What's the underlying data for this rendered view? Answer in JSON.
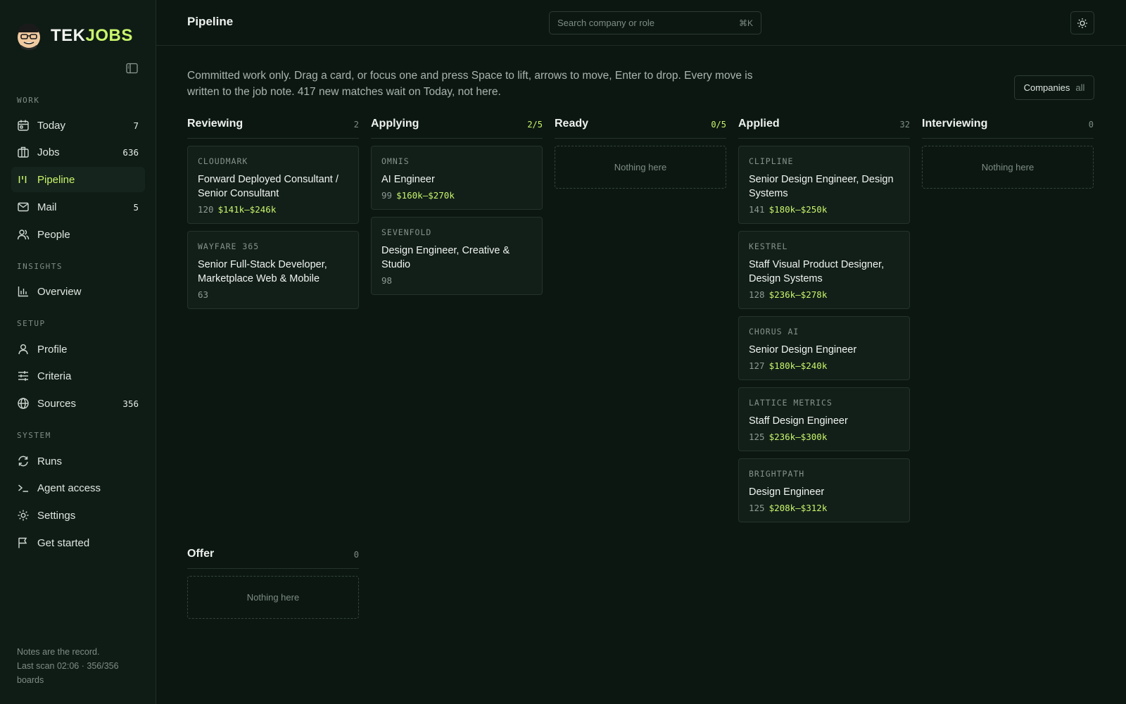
{
  "brand": {
    "part1": "TEK",
    "part2": "JOBS"
  },
  "sidebar": {
    "sections": {
      "work": "WORK",
      "insights": "INSIGHTS",
      "setup": "SETUP",
      "system": "SYSTEM"
    },
    "items": [
      {
        "label": "Today",
        "count": "7",
        "icon": "calendar-icon"
      },
      {
        "label": "Jobs",
        "count": "636",
        "icon": "briefcase-icon"
      },
      {
        "label": "Pipeline",
        "count": "",
        "icon": "kanban-icon"
      },
      {
        "label": "Mail",
        "count": "5",
        "icon": "mail-icon"
      },
      {
        "label": "People",
        "count": "",
        "icon": "people-icon"
      },
      {
        "label": "Overview",
        "count": "",
        "icon": "bar-chart-icon"
      },
      {
        "label": "Profile",
        "count": "",
        "icon": "user-icon"
      },
      {
        "label": "Criteria",
        "count": "",
        "icon": "sliders-icon"
      },
      {
        "label": "Sources",
        "count": "356",
        "icon": "globe-icon"
      },
      {
        "label": "Runs",
        "count": "",
        "icon": "refresh-icon"
      },
      {
        "label": "Agent access",
        "count": "",
        "icon": "terminal-icon"
      },
      {
        "label": "Settings",
        "count": "",
        "icon": "gear-icon"
      },
      {
        "label": "Get started",
        "count": "",
        "icon": "flag-icon"
      }
    ],
    "footer": {
      "line1": "Notes are the record.",
      "line2": "Last scan 02:06 · 356/356 boards"
    }
  },
  "header": {
    "title": "Pipeline",
    "search_placeholder": "Search company or role",
    "search_shortcut": "⌘K"
  },
  "intro": "Committed work only. Drag a card, or focus one and press Space to lift, arrows to move, Enter to drop. Every move is written to the job note. 417 new matches wait on Today, not here.",
  "companies_filter": {
    "label": "Companies",
    "value": "all"
  },
  "empty_text": "Nothing here",
  "columns": {
    "reviewing": {
      "title": "Reviewing",
      "count": "2",
      "cards": [
        {
          "company": "CLOUDMARK",
          "role": "Forward Deployed Consultant / Senior Consultant",
          "score": "120",
          "salary": "$141k–$246k"
        },
        {
          "company": "WAYFARE 365",
          "role": "Senior Full-Stack Developer, Marketplace Web & Mobile",
          "score": "63",
          "salary": ""
        }
      ]
    },
    "applying": {
      "title": "Applying",
      "count": "2/5",
      "cards": [
        {
          "company": "OMNIS",
          "role": "AI Engineer",
          "score": "99",
          "salary": "$160k–$270k"
        },
        {
          "company": "SEVENFOLD",
          "role": "Design Engineer, Creative & Studio",
          "score": "98",
          "salary": ""
        }
      ]
    },
    "ready": {
      "title": "Ready",
      "count": "0/5",
      "cards": []
    },
    "applied": {
      "title": "Applied",
      "count": "32",
      "cards": [
        {
          "company": "CLIPLINE",
          "role": "Senior Design Engineer, Design Systems",
          "score": "141",
          "salary": "$180k–$250k"
        },
        {
          "company": "KESTREL",
          "role": "Staff Visual Product Designer, Design Systems",
          "score": "128",
          "salary": "$236k–$278k"
        },
        {
          "company": "CHORUS AI",
          "role": "Senior Design Engineer",
          "score": "127",
          "salary": "$180k–$240k"
        },
        {
          "company": "LATTICE METRICS",
          "role": "Staff Design Engineer",
          "score": "125",
          "salary": "$236k–$300k"
        },
        {
          "company": "BRIGHTPATH",
          "role": "Design Engineer",
          "score": "125",
          "salary": "$208k–$312k"
        }
      ]
    },
    "interviewing": {
      "title": "Interviewing",
      "count": "0",
      "cards": []
    },
    "offer": {
      "title": "Offer",
      "count": "0",
      "cards": []
    }
  },
  "colors": {
    "accent": "#c9f56b",
    "background": "#0c1712",
    "sidebar": "#0f1c16",
    "card": "#121f19"
  }
}
